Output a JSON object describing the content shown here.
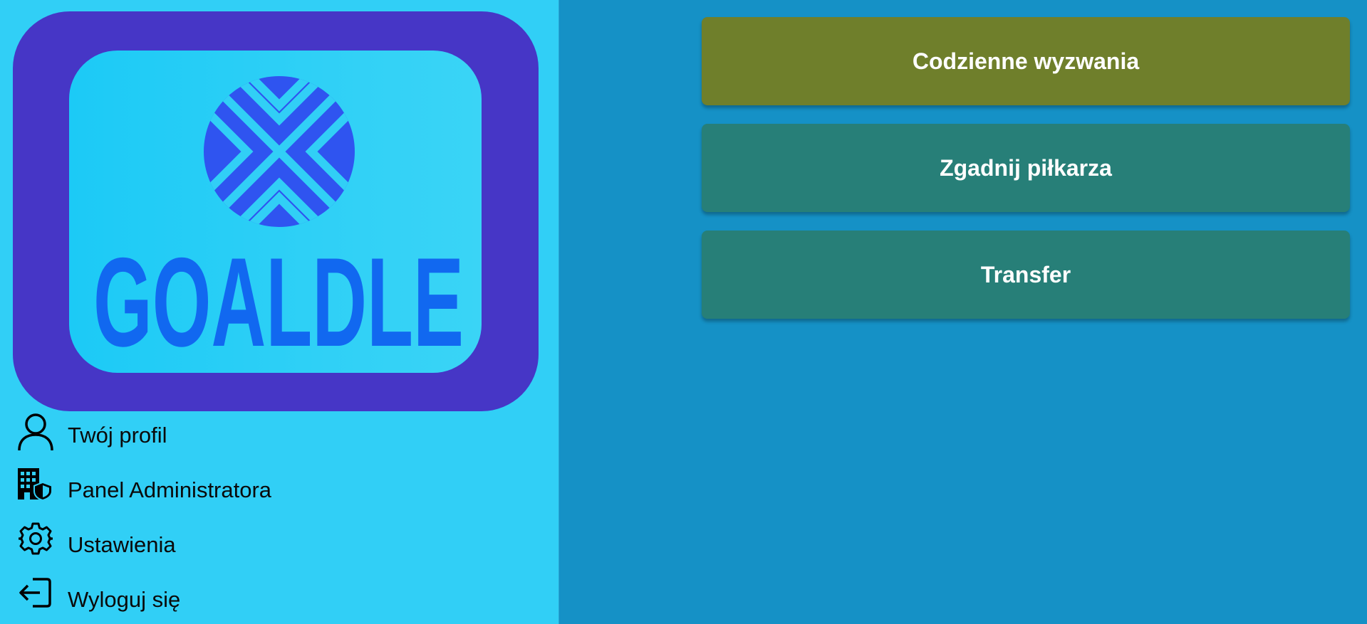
{
  "sidebar": {
    "logo_text": "GOALDLE",
    "items": [
      {
        "label": "Twój profil",
        "icon": "user-icon"
      },
      {
        "label": "Panel Administratora",
        "icon": "admin-building-shield-icon"
      },
      {
        "label": "Ustawienia",
        "icon": "gear-icon"
      },
      {
        "label": "Wyloguj się",
        "icon": "logout-icon"
      }
    ]
  },
  "main": {
    "buttons": [
      {
        "label": "Codzienne wyzwania",
        "color": "#6f7f2b"
      },
      {
        "label": "Zgadnij piłkarza",
        "color": "#277f78"
      },
      {
        "label": "Transfer",
        "color": "#277f78"
      }
    ]
  },
  "colors": {
    "page_background": "#1591c6",
    "sidebar_background": "#31cff6",
    "logo_frame": "#4636c6",
    "logo_accent": "#2f54f0"
  }
}
